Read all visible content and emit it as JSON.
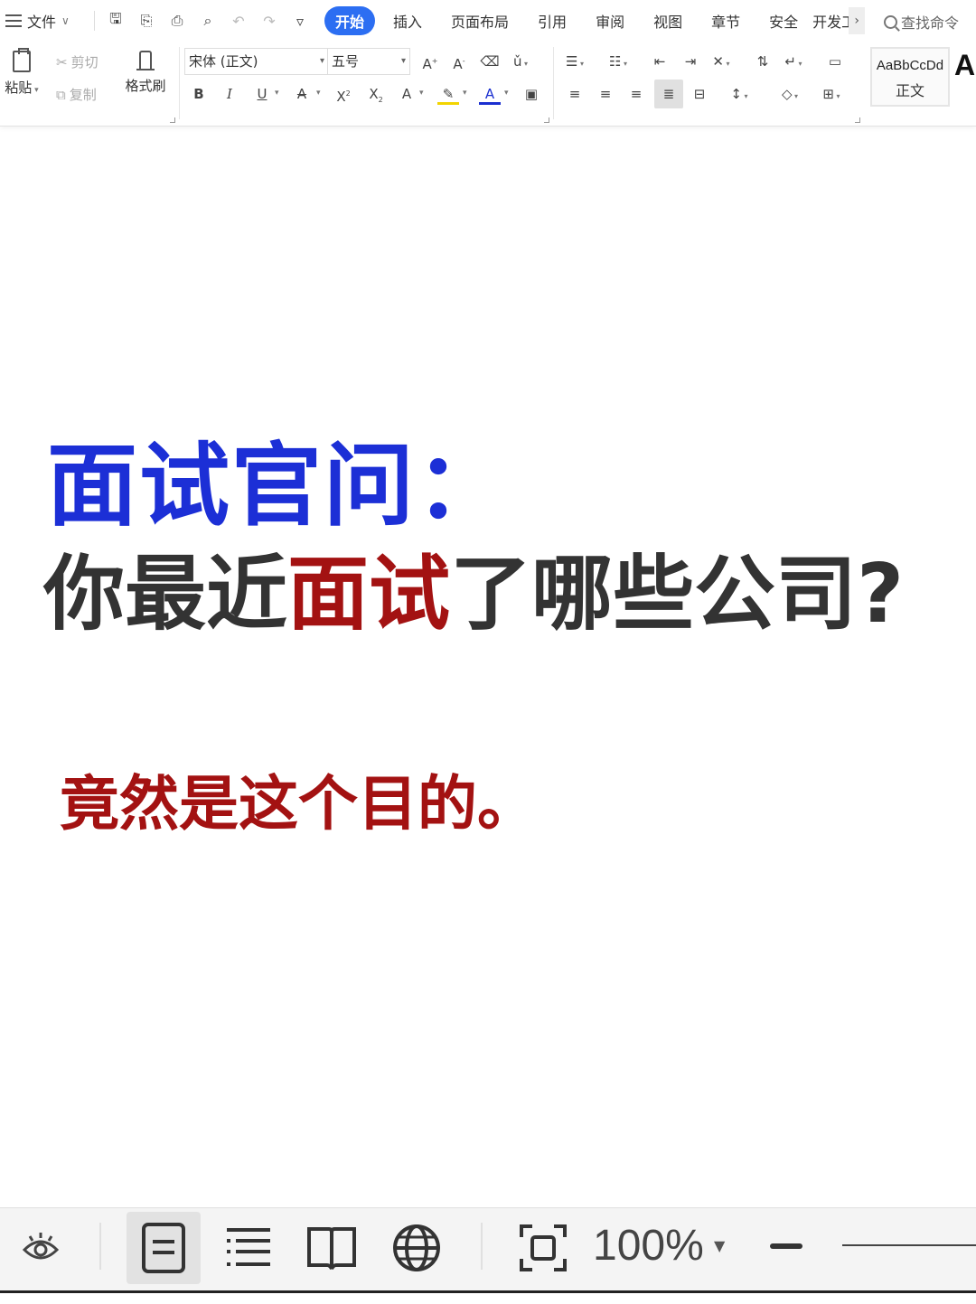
{
  "menubar": {
    "file_label": "文件",
    "tabs": [
      "开始",
      "插入",
      "页面布局",
      "引用",
      "审阅",
      "视图",
      "章节",
      "安全",
      "开发工"
    ],
    "search_placeholder": "查找命令"
  },
  "ribbon": {
    "paste_label": "粘贴",
    "cut_label": "剪切",
    "copy_label": "复制",
    "format_painter_label": "格式刷",
    "font_name": "宋体 (正文)",
    "font_size": "五号",
    "style_preview": "AaBbCcDd",
    "style_name": "正文",
    "style_next_preview": "A"
  },
  "document": {
    "line1": "面试官问：",
    "line2_a": "你最近",
    "line2_b": "面试",
    "line2_c": "了哪些公司?",
    "line3": "竟然是这个目的。"
  },
  "statusbar": {
    "zoom_level": "100%"
  },
  "colors": {
    "active_tab": "#2c6ef2",
    "heading_blue": "#1c2fd6",
    "emphasis_red": "#a31212",
    "body_gray": "#333333"
  }
}
